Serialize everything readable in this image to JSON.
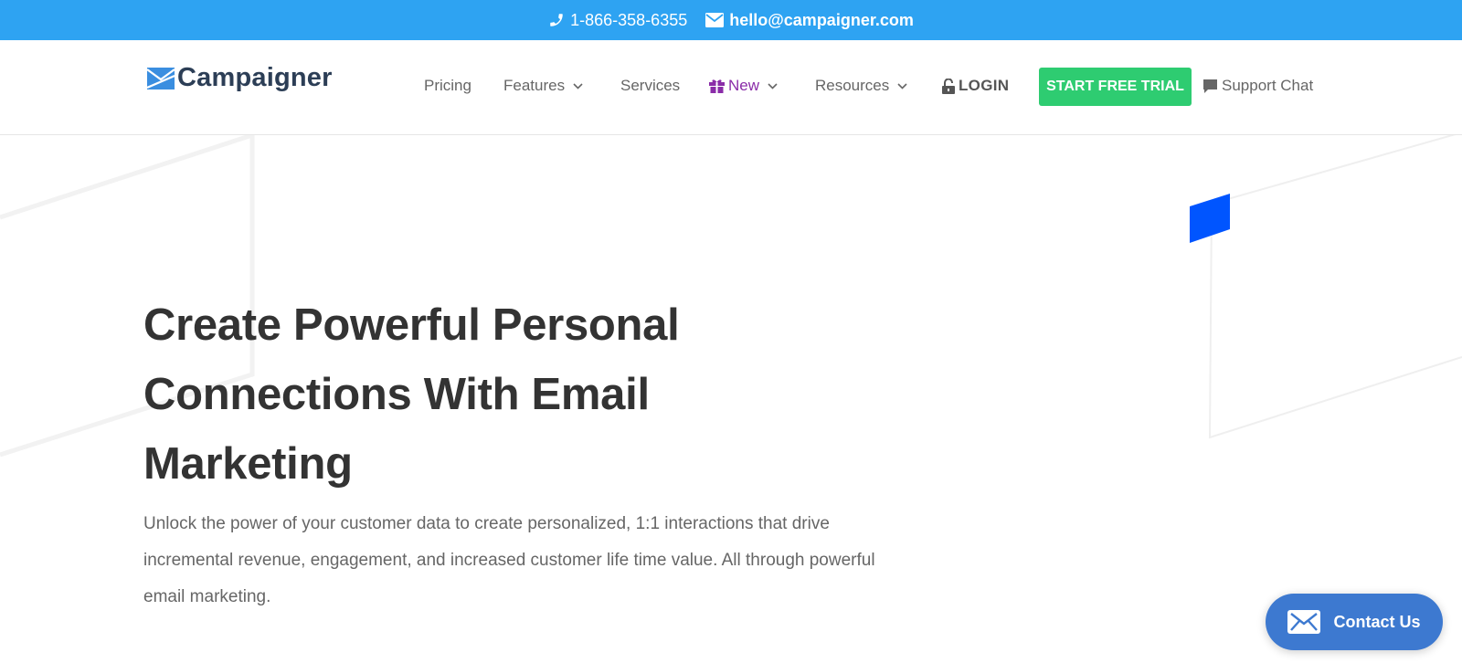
{
  "topbar": {
    "phone": "1-866-358-6355",
    "email": "hello@campaigner.com"
  },
  "header": {
    "logo_text": "Campaigner",
    "nav": {
      "pricing": "Pricing",
      "features": "Features",
      "services": "Services",
      "new": "New",
      "resources": "Resources",
      "login": "LOGIN"
    },
    "cta_label": "START FREE TRIAL",
    "support_label": "Support Chat"
  },
  "hero": {
    "title_lines": [
      "Create Powerful Personal",
      "Connections With Email",
      "Marketing"
    ],
    "description": "Unlock the power of your customer data to create personalized, 1:1 interactions that drive incremental revenue, engagement, and increased customer life time value. All through powerful email marketing."
  },
  "contact": {
    "label": "Contact Us"
  },
  "colors": {
    "topbar_bg": "#2ea3f2",
    "cta_green": "#2ecc71",
    "new_purple": "#8a2ca8",
    "contact_blue": "#3d79d0",
    "accent_shape_blue": "#0055ff"
  }
}
